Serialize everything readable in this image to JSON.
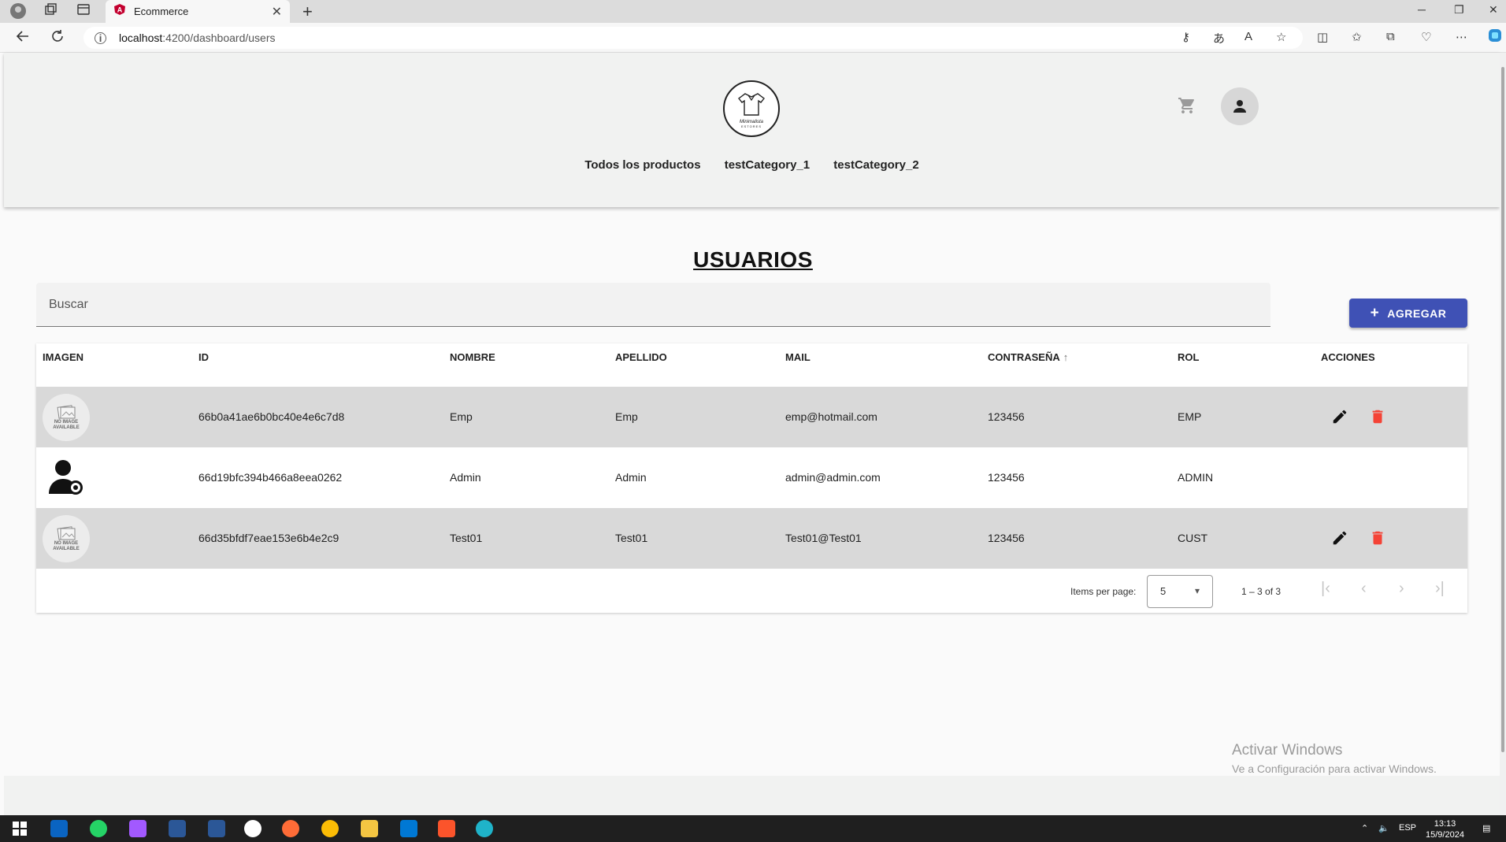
{
  "browser": {
    "tab_title": "Ecommerce",
    "url_host": "localhost",
    "url_path": ":4200/dashboard/users"
  },
  "header": {
    "logo_text": "Minimalista",
    "logo_subtext": "ESTORES",
    "categories": [
      "Todos los productos",
      "testCategory_1",
      "testCategory_2"
    ]
  },
  "page": {
    "title": "USUARIOS",
    "search_placeholder": "Buscar",
    "add_label": "AGREGAR"
  },
  "table": {
    "columns": [
      "IMAGEN",
      "ID",
      "NOMBRE",
      "APELLIDO",
      "MAIL",
      "CONTRASEÑA",
      "ROL",
      "ACCIONES"
    ],
    "no_image_text": "NO IMAGE AVAILABLE",
    "rows": [
      {
        "id": "66b0a41ae6b0bc40e4e6c7d8",
        "nombre": "Emp",
        "apellido": "Emp",
        "mail": "emp@hotmail.com",
        "password": "123456",
        "rol": "EMP",
        "image": "no-image"
      },
      {
        "id": "66d19bfc394b466a8eea0262",
        "nombre": "Admin",
        "apellido": "Admin",
        "mail": "admin@admin.com",
        "password": "123456",
        "rol": "ADMIN",
        "image": "admin-user"
      },
      {
        "id": "66d35bfdf7eae153e6b4e2c9",
        "nombre": "Test01",
        "apellido": "Test01",
        "mail": "Test01@Test01",
        "password": "123456",
        "rol": "CUST",
        "image": "no-image"
      }
    ]
  },
  "paginator": {
    "items_per_page_label": "Items per page:",
    "page_size": "5",
    "range": "1 – 3 of 3"
  },
  "watermark": {
    "line1": "Activar Windows",
    "line2": "Ve a Configuración para activar Windows."
  },
  "taskbar": {
    "lang": "ESP",
    "time": "13:13",
    "date": "15/9/2024"
  },
  "colors": {
    "primary": "#3f51b5",
    "delete": "#f44336",
    "row_alt": "#d9d9d9"
  }
}
